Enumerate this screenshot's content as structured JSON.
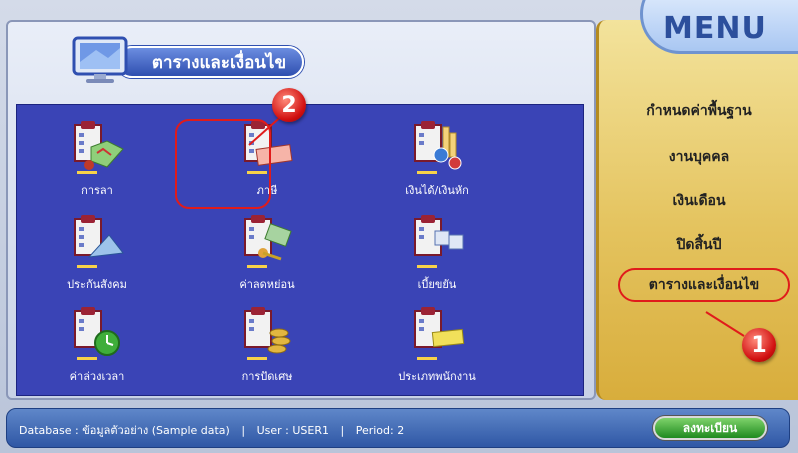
{
  "panel": {
    "title": "ตารางและเงื่อนไข"
  },
  "grid": [
    {
      "label": "การลา",
      "icon": "leave-map-icon"
    },
    {
      "label": "ภาษี",
      "icon": "tax-ticket-icon"
    },
    {
      "label": "เงินได้/เงินหัก",
      "icon": "income-deduction-icon"
    },
    {
      "label": "ประกันสังคม",
      "icon": "social-security-icon"
    },
    {
      "label": "ค่าลดหย่อน",
      "icon": "allowance-icon"
    },
    {
      "label": "เบี้ยขยัน",
      "icon": "diligence-bonus-icon"
    },
    {
      "label": "ค่าล่วงเวลา",
      "icon": "overtime-clock-icon"
    },
    {
      "label": "การปัดเศษ",
      "icon": "rounding-coins-icon"
    },
    {
      "label": "ประเภทพนักงาน",
      "icon": "employee-type-icon"
    }
  ],
  "menu": {
    "header": "MENU",
    "items": [
      {
        "label": "กำหนดค่าพื้นฐาน"
      },
      {
        "label": "งานบุคคล"
      },
      {
        "label": "เงินเดือน"
      },
      {
        "label": "ปิดสิ้นปี"
      },
      {
        "label": "ตารางและเงื่อนไข"
      }
    ]
  },
  "badges": {
    "one": "1",
    "two": "2"
  },
  "status": {
    "database_label": "Database :",
    "database_value": "ข้อมูลตัวอย่าง (Sample data)",
    "user_label": "User :",
    "user_value": "USER1",
    "period_label": "Period:",
    "period_value": "2",
    "separator": "|",
    "register_button": "ลงทะเบียน"
  },
  "colors": {
    "panel_blue": "#3a44b6",
    "menu_gold": "#e4c35e",
    "highlight_red": "#e01b1b"
  }
}
